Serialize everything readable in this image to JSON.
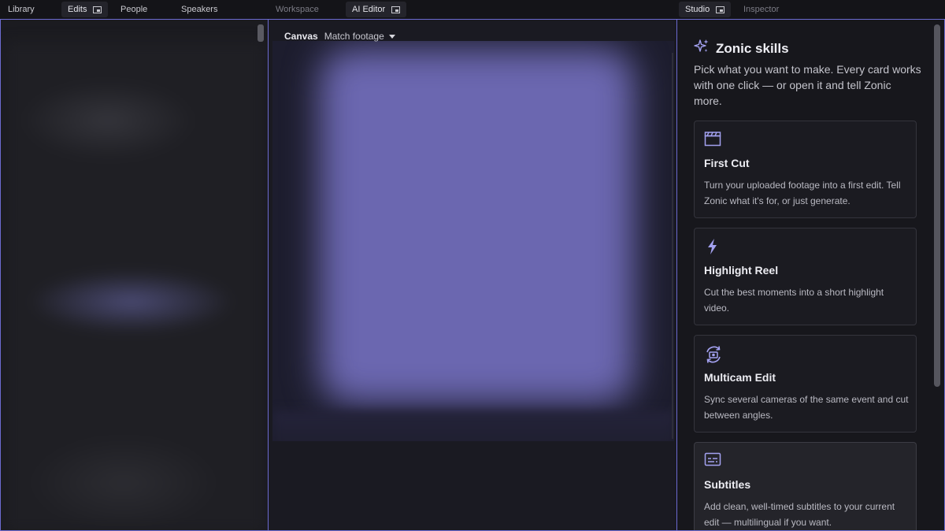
{
  "tabs": {
    "library": "Library",
    "edits": "Edits",
    "people": "People",
    "speakers": "Speakers",
    "workspace": "Workspace",
    "ai_editor": "AI Editor",
    "studio": "Studio",
    "inspector": "Inspector"
  },
  "canvas": {
    "title": "Canvas",
    "match_option": "Match footage"
  },
  "skills": {
    "title": "Zonic skills",
    "description": "Pick what you want to make. Every card works with one click — or open it and tell Zonic more.",
    "cards": [
      {
        "name": "First Cut",
        "icon": "clapperboard-icon",
        "text": "Turn your uploaded footage into a first edit. Tell Zonic what it's for, or just generate."
      },
      {
        "name": "Highlight Reel",
        "icon": "lightning-icon",
        "text": "Cut the best moments into a short highlight video."
      },
      {
        "name": "Multicam Edit",
        "icon": "multicam-icon",
        "text": "Sync several cameras of the same event and cut between angles."
      },
      {
        "name": "Subtitles",
        "icon": "subtitles-icon",
        "text": "Add clean, well-timed subtitles to your current edit — multilingual if you want."
      }
    ]
  },
  "colors": {
    "accent": "#6c6bd1",
    "icon_tint": "#a3a1f0"
  }
}
